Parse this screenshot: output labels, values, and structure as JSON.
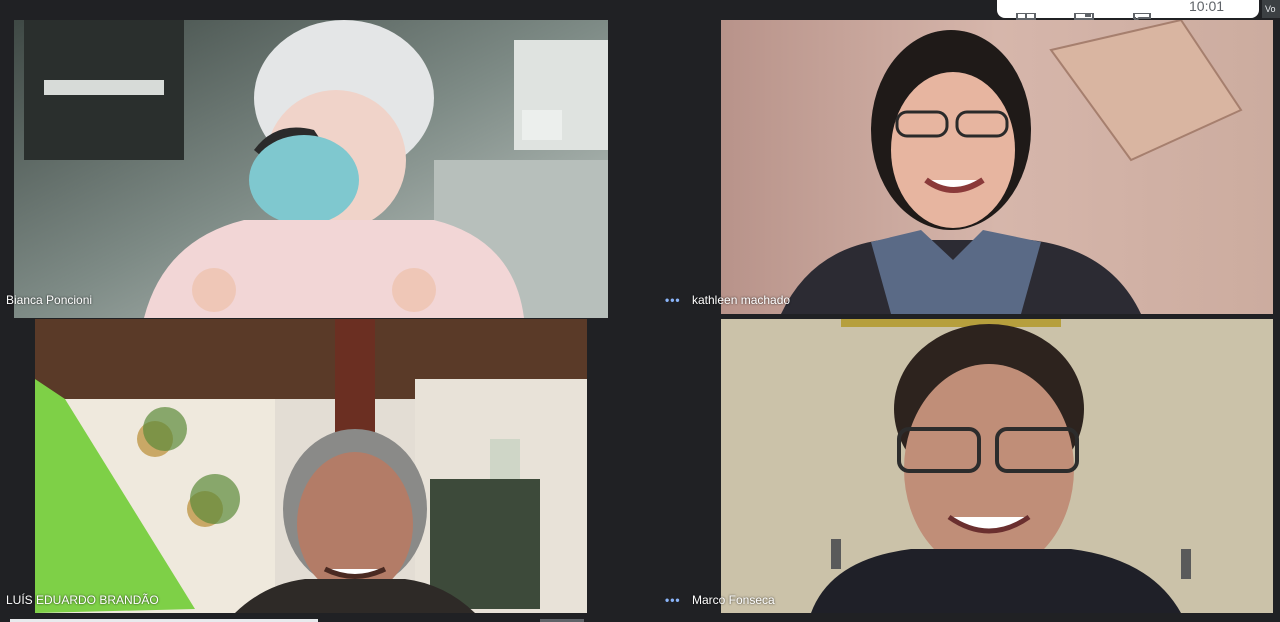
{
  "toolbar": {
    "clock": "10:01",
    "corner_text": "Vo",
    "icons": [
      "grid-icon",
      "present-icon",
      "chat-icon"
    ]
  },
  "participants": [
    {
      "name": "Bianca Poncioni",
      "more_options": ""
    },
    {
      "name": "kathleen machado",
      "more_options": "•••"
    },
    {
      "name": "LUÍS EDUARDO BRANDÃO",
      "more_options": ""
    },
    {
      "name": "Marco Fonseca",
      "more_options": "•••"
    }
  ],
  "colors": {
    "background": "#202124",
    "options_dots": "#8ab4f8"
  }
}
